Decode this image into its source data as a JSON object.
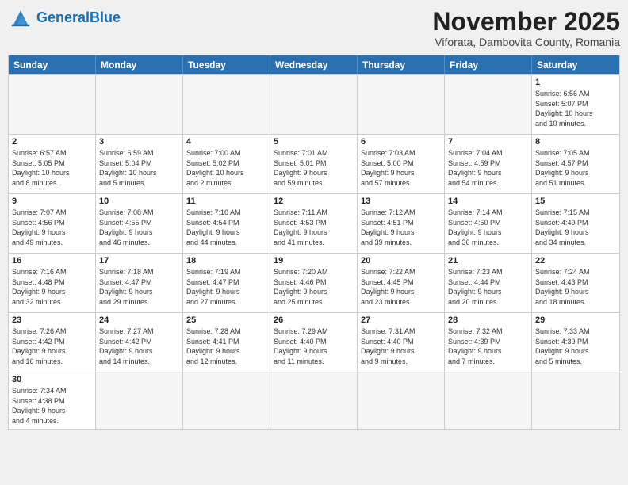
{
  "header": {
    "logo_general": "General",
    "logo_blue": "Blue",
    "month_title": "November 2025",
    "subtitle": "Viforata, Dambovita County, Romania"
  },
  "days": [
    "Sunday",
    "Monday",
    "Tuesday",
    "Wednesday",
    "Thursday",
    "Friday",
    "Saturday"
  ],
  "weeks": [
    [
      {
        "day": "",
        "empty": true,
        "info": ""
      },
      {
        "day": "",
        "empty": true,
        "info": ""
      },
      {
        "day": "",
        "empty": true,
        "info": ""
      },
      {
        "day": "",
        "empty": true,
        "info": ""
      },
      {
        "day": "",
        "empty": true,
        "info": ""
      },
      {
        "day": "",
        "empty": true,
        "info": ""
      },
      {
        "day": "1",
        "empty": false,
        "info": "Sunrise: 6:56 AM\nSunset: 5:07 PM\nDaylight: 10 hours\nand 10 minutes."
      }
    ],
    [
      {
        "day": "2",
        "empty": false,
        "info": "Sunrise: 6:57 AM\nSunset: 5:05 PM\nDaylight: 10 hours\nand 8 minutes."
      },
      {
        "day": "3",
        "empty": false,
        "info": "Sunrise: 6:59 AM\nSunset: 5:04 PM\nDaylight: 10 hours\nand 5 minutes."
      },
      {
        "day": "4",
        "empty": false,
        "info": "Sunrise: 7:00 AM\nSunset: 5:02 PM\nDaylight: 10 hours\nand 2 minutes."
      },
      {
        "day": "5",
        "empty": false,
        "info": "Sunrise: 7:01 AM\nSunset: 5:01 PM\nDaylight: 9 hours\nand 59 minutes."
      },
      {
        "day": "6",
        "empty": false,
        "info": "Sunrise: 7:03 AM\nSunset: 5:00 PM\nDaylight: 9 hours\nand 57 minutes."
      },
      {
        "day": "7",
        "empty": false,
        "info": "Sunrise: 7:04 AM\nSunset: 4:59 PM\nDaylight: 9 hours\nand 54 minutes."
      },
      {
        "day": "8",
        "empty": false,
        "info": "Sunrise: 7:05 AM\nSunset: 4:57 PM\nDaylight: 9 hours\nand 51 minutes."
      }
    ],
    [
      {
        "day": "9",
        "empty": false,
        "info": "Sunrise: 7:07 AM\nSunset: 4:56 PM\nDaylight: 9 hours\nand 49 minutes."
      },
      {
        "day": "10",
        "empty": false,
        "info": "Sunrise: 7:08 AM\nSunset: 4:55 PM\nDaylight: 9 hours\nand 46 minutes."
      },
      {
        "day": "11",
        "empty": false,
        "info": "Sunrise: 7:10 AM\nSunset: 4:54 PM\nDaylight: 9 hours\nand 44 minutes."
      },
      {
        "day": "12",
        "empty": false,
        "info": "Sunrise: 7:11 AM\nSunset: 4:53 PM\nDaylight: 9 hours\nand 41 minutes."
      },
      {
        "day": "13",
        "empty": false,
        "info": "Sunrise: 7:12 AM\nSunset: 4:51 PM\nDaylight: 9 hours\nand 39 minutes."
      },
      {
        "day": "14",
        "empty": false,
        "info": "Sunrise: 7:14 AM\nSunset: 4:50 PM\nDaylight: 9 hours\nand 36 minutes."
      },
      {
        "day": "15",
        "empty": false,
        "info": "Sunrise: 7:15 AM\nSunset: 4:49 PM\nDaylight: 9 hours\nand 34 minutes."
      }
    ],
    [
      {
        "day": "16",
        "empty": false,
        "info": "Sunrise: 7:16 AM\nSunset: 4:48 PM\nDaylight: 9 hours\nand 32 minutes."
      },
      {
        "day": "17",
        "empty": false,
        "info": "Sunrise: 7:18 AM\nSunset: 4:47 PM\nDaylight: 9 hours\nand 29 minutes."
      },
      {
        "day": "18",
        "empty": false,
        "info": "Sunrise: 7:19 AM\nSunset: 4:47 PM\nDaylight: 9 hours\nand 27 minutes."
      },
      {
        "day": "19",
        "empty": false,
        "info": "Sunrise: 7:20 AM\nSunset: 4:46 PM\nDaylight: 9 hours\nand 25 minutes."
      },
      {
        "day": "20",
        "empty": false,
        "info": "Sunrise: 7:22 AM\nSunset: 4:45 PM\nDaylight: 9 hours\nand 23 minutes."
      },
      {
        "day": "21",
        "empty": false,
        "info": "Sunrise: 7:23 AM\nSunset: 4:44 PM\nDaylight: 9 hours\nand 20 minutes."
      },
      {
        "day": "22",
        "empty": false,
        "info": "Sunrise: 7:24 AM\nSunset: 4:43 PM\nDaylight: 9 hours\nand 18 minutes."
      }
    ],
    [
      {
        "day": "23",
        "empty": false,
        "info": "Sunrise: 7:26 AM\nSunset: 4:42 PM\nDaylight: 9 hours\nand 16 minutes."
      },
      {
        "day": "24",
        "empty": false,
        "info": "Sunrise: 7:27 AM\nSunset: 4:42 PM\nDaylight: 9 hours\nand 14 minutes."
      },
      {
        "day": "25",
        "empty": false,
        "info": "Sunrise: 7:28 AM\nSunset: 4:41 PM\nDaylight: 9 hours\nand 12 minutes."
      },
      {
        "day": "26",
        "empty": false,
        "info": "Sunrise: 7:29 AM\nSunset: 4:40 PM\nDaylight: 9 hours\nand 11 minutes."
      },
      {
        "day": "27",
        "empty": false,
        "info": "Sunrise: 7:31 AM\nSunset: 4:40 PM\nDaylight: 9 hours\nand 9 minutes."
      },
      {
        "day": "28",
        "empty": false,
        "info": "Sunrise: 7:32 AM\nSunset: 4:39 PM\nDaylight: 9 hours\nand 7 minutes."
      },
      {
        "day": "29",
        "empty": false,
        "info": "Sunrise: 7:33 AM\nSunset: 4:39 PM\nDaylight: 9 hours\nand 5 minutes."
      }
    ],
    [
      {
        "day": "30",
        "empty": false,
        "info": "Sunrise: 7:34 AM\nSunset: 4:38 PM\nDaylight: 9 hours\nand 4 minutes."
      },
      {
        "day": "",
        "empty": true,
        "info": ""
      },
      {
        "day": "",
        "empty": true,
        "info": ""
      },
      {
        "day": "",
        "empty": true,
        "info": ""
      },
      {
        "day": "",
        "empty": true,
        "info": ""
      },
      {
        "day": "",
        "empty": true,
        "info": ""
      },
      {
        "day": "",
        "empty": true,
        "info": ""
      }
    ]
  ]
}
